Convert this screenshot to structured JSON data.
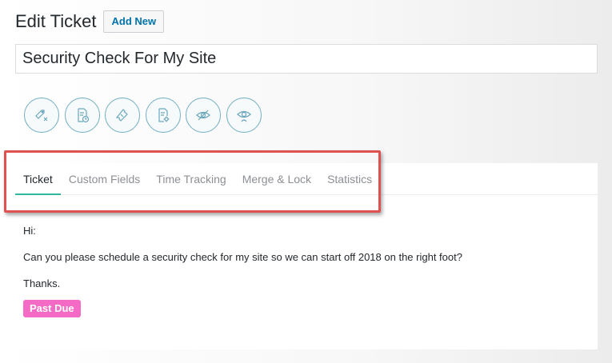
{
  "header": {
    "title": "Edit Ticket",
    "add_new_label": "Add New"
  },
  "ticket": {
    "title_value": "Security Check For My Site"
  },
  "icons": [
    "ticket-close-icon",
    "document-clock-icon",
    "ticket-icon",
    "document-settings-icon",
    "eye-hidden-icon",
    "eye-user-icon"
  ],
  "tabs": [
    {
      "label": "Ticket",
      "active": true
    },
    {
      "label": "Custom Fields",
      "active": false
    },
    {
      "label": "Time Tracking",
      "active": false
    },
    {
      "label": "Merge & Lock",
      "active": false
    },
    {
      "label": "Statistics",
      "active": false
    }
  ],
  "message": {
    "greeting": "Hi:",
    "body": "Can you please schedule a security check for my site so we can start off 2018 on the right foot?",
    "closing": "Thanks."
  },
  "status": {
    "badge_label": "Past Due"
  },
  "colors": {
    "accent_link": "#0073aa",
    "icon_stroke": "#6aa6bd",
    "tab_active_underline": "#2fb89e",
    "badge_bg": "#f56ac5",
    "highlight_border": "#e05252"
  }
}
